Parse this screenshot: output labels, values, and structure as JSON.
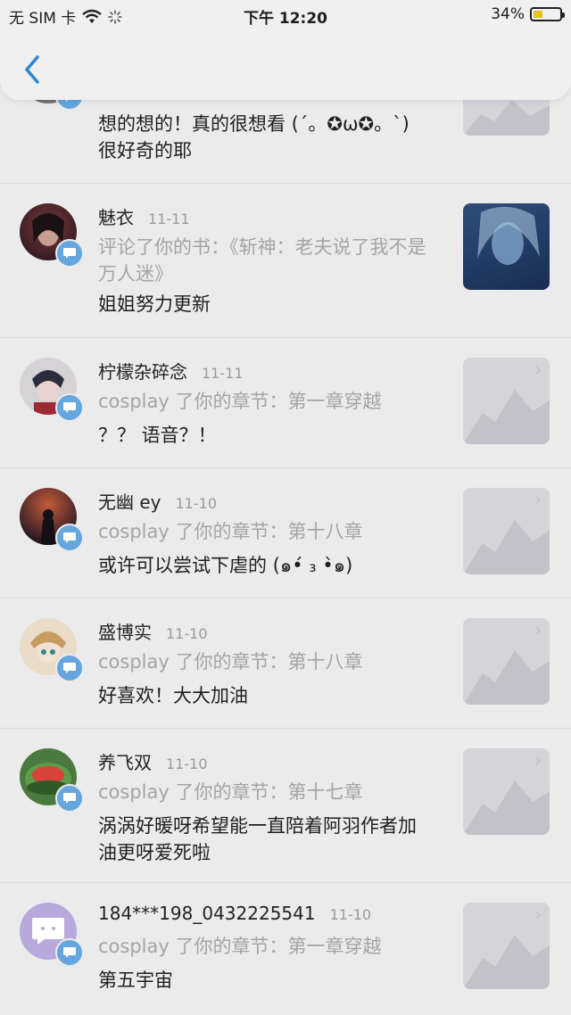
{
  "status_bar": {
    "carrier": "无 SIM 卡",
    "time": "下午 12:20",
    "battery": "34%",
    "battery_level": 0.34
  },
  "nav": {
    "back_icon": "chevron-left-icon"
  },
  "messages": [
    {
      "comment": "想的想的！真的很想看 (´。✪ω✪。`)\n很好奇的耶"
    },
    {
      "name": "魅衣",
      "date": "11-11",
      "action": "评论了你的书：《斩神：老夫说了我不是万人迷》",
      "comment": "姐姐努力更新"
    },
    {
      "name": "柠檬杂碎念",
      "date": "11-11",
      "action": "cosplay 了你的章节：第一章穿越",
      "comment": "？？ 语音？！"
    },
    {
      "name": "无幽 ey",
      "date": "11-10",
      "action": "cosplay 了你的章节：第十八章",
      "comment": "或许可以尝试下虐的 (๑•́ ₃ •̀๑)"
    },
    {
      "name": "盛博实",
      "date": "11-10",
      "action": "cosplay 了你的章节：第十八章",
      "comment": "好喜欢！大大加油"
    },
    {
      "name": "养飞双",
      "date": "11-10",
      "action": "cosplay 了你的章节：第十七章",
      "comment": "涡涡好暖呀希望能一直陪着阿羽作者加油更呀爱死啦"
    },
    {
      "name": "184***198_0432225541",
      "date": "11-10",
      "action": "cosplay 了你的章节：第一章穿越",
      "comment": "第五宇宙"
    }
  ]
}
